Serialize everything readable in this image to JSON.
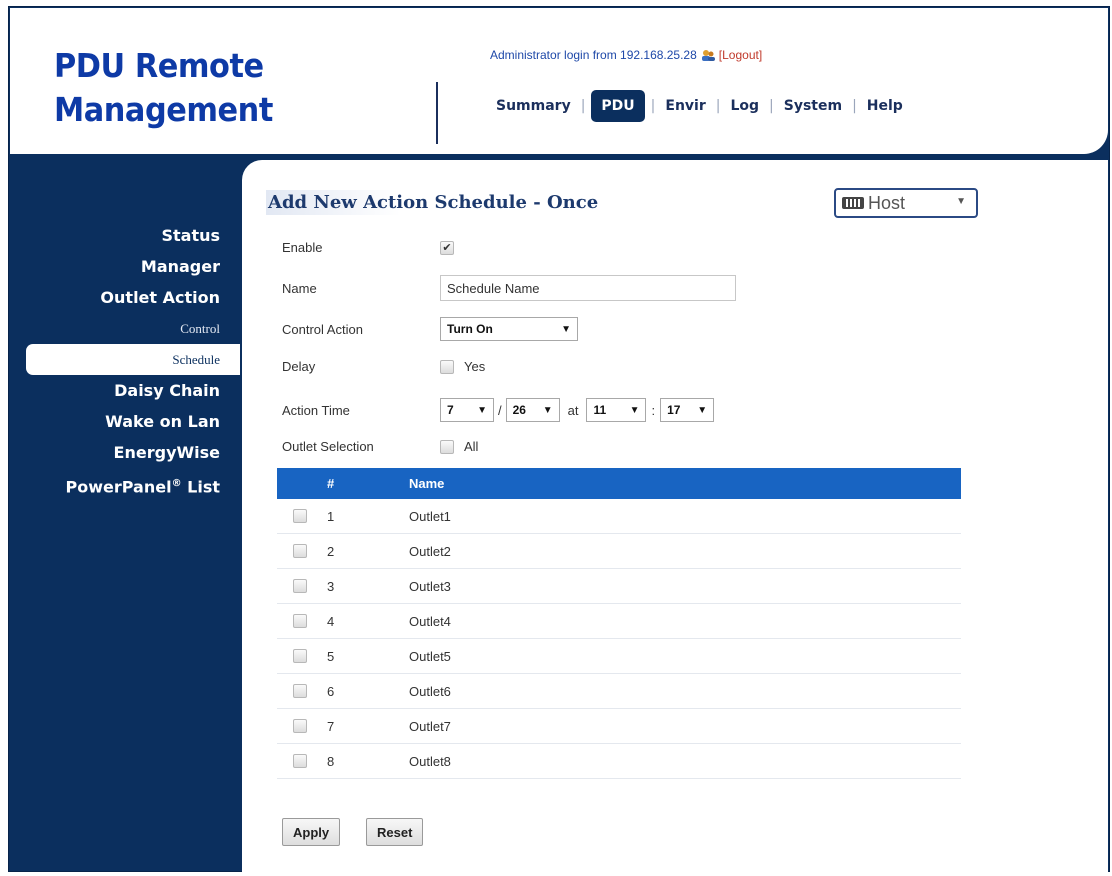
{
  "header": {
    "logo_line1": "PDU Remote",
    "logo_line2": "Management",
    "login_text": "Administrator login from 192.168.25.28",
    "logout_label": "[Logout]",
    "user_icon": "user-icon"
  },
  "nav": {
    "tabs": [
      {
        "label": "Summary"
      },
      {
        "label": "PDU"
      },
      {
        "label": "Envir"
      },
      {
        "label": "Log"
      },
      {
        "label": "System"
      },
      {
        "label": "Help"
      }
    ],
    "active": "PDU"
  },
  "sidebar": {
    "items": [
      {
        "label": "Status"
      },
      {
        "label": "Manager"
      },
      {
        "label": "Outlet Action"
      },
      {
        "label": "Control"
      },
      {
        "label": "Schedule"
      },
      {
        "label": "Daisy Chain"
      },
      {
        "label": "Wake on Lan"
      },
      {
        "label": "EnergyWise"
      },
      {
        "label": "PowerPanel",
        "sup": "®",
        "suffix": " List"
      }
    ]
  },
  "page": {
    "title": "Add New Action Schedule - Once",
    "host_select": "Host",
    "host_icon": "keyboard-icon"
  },
  "form": {
    "enable_label": "Enable",
    "enable_checked": true,
    "name_label": "Name",
    "name_value": "Schedule Name",
    "control_action_label": "Control Action",
    "control_action_value": "Turn On",
    "delay_label": "Delay",
    "delay_option": "Yes",
    "action_time_label": "Action Time",
    "month": "7",
    "day": "26",
    "slash": "/",
    "at_label": "at",
    "hour": "11",
    "colon": ":",
    "minute": "17",
    "outlet_selection_label": "Outlet Selection",
    "all_label": "All"
  },
  "table": {
    "headers": {
      "num": "#",
      "name": "Name"
    },
    "rows": [
      {
        "num": "1",
        "name": "Outlet1"
      },
      {
        "num": "2",
        "name": "Outlet2"
      },
      {
        "num": "3",
        "name": "Outlet3"
      },
      {
        "num": "4",
        "name": "Outlet4"
      },
      {
        "num": "5",
        "name": "Outlet5"
      },
      {
        "num": "6",
        "name": "Outlet6"
      },
      {
        "num": "7",
        "name": "Outlet7"
      },
      {
        "num": "8",
        "name": "Outlet8"
      }
    ]
  },
  "buttons": {
    "apply": "Apply",
    "reset": "Reset"
  },
  "colors": {
    "brand_navy": "#0b2f5e",
    "logo_blue": "#0e3aa6",
    "table_header": "#1864c2"
  }
}
